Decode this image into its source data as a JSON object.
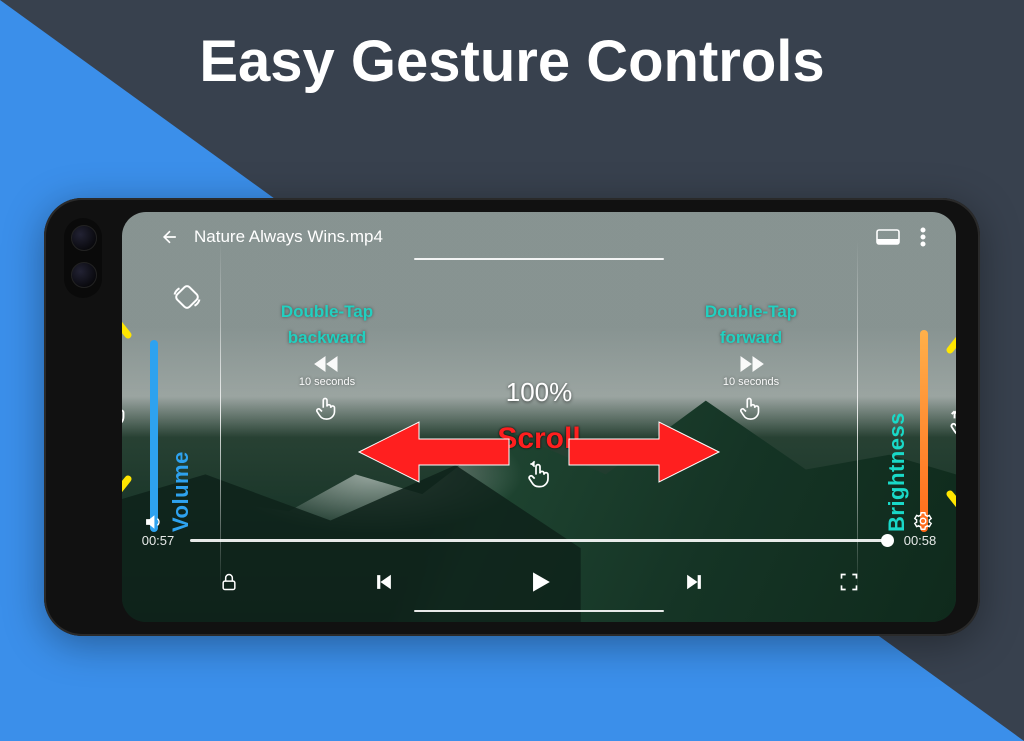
{
  "headline": "Easy Gesture Controls",
  "video": {
    "title": "Nature Always Wins.mp4",
    "currentTime": "00:57",
    "duration": "00:58",
    "zoom": "100%"
  },
  "gestures": {
    "volumeLabel": "Volume",
    "brightnessLabel": "Brightness",
    "scrollLabel": "Scroll",
    "doubleTapBackLine1": "Double-Tap",
    "doubleTapBackLine2": "backward",
    "doubleTapFwdLine1": "Double-Tap",
    "doubleTapFwdLine2": "forward",
    "seekAmount": "10 seconds"
  }
}
